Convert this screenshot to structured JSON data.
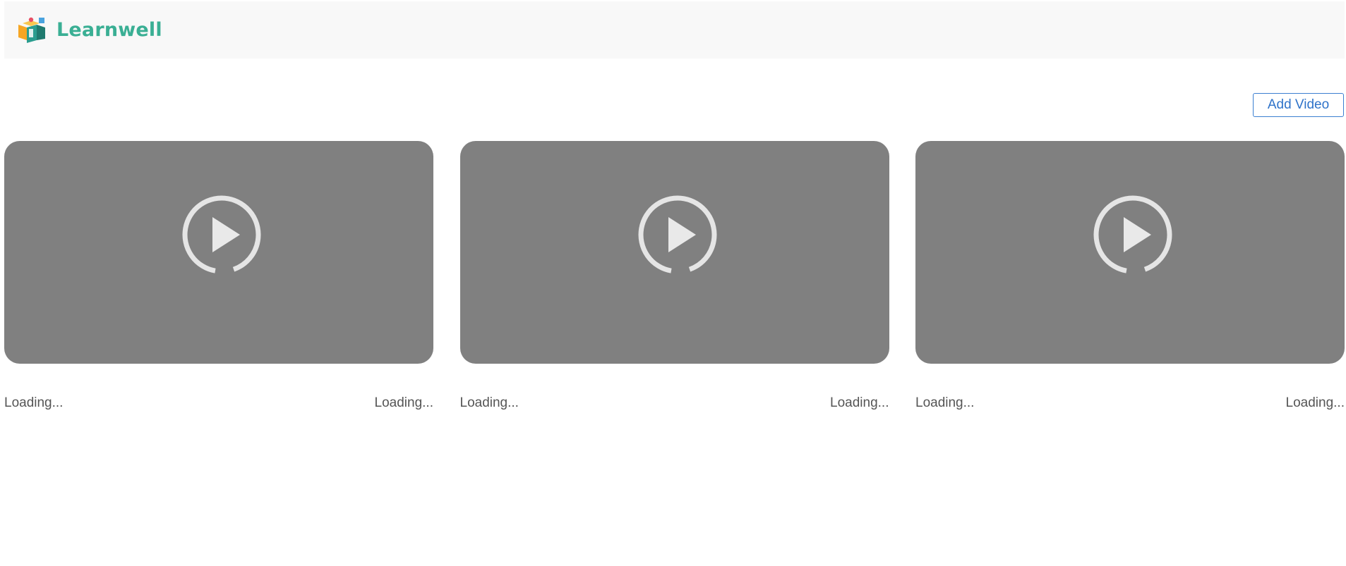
{
  "header": {
    "brand": "Learnwell",
    "logo_icon": "learnwell-logo-icon",
    "brand_color": "#3aaf94"
  },
  "toolbar": {
    "add_video_label": "Add Video"
  },
  "videos": [
    {
      "title": "Loading...",
      "meta": "Loading...",
      "icon": "play-circle-icon"
    },
    {
      "title": "Loading...",
      "meta": "Loading...",
      "icon": "play-circle-icon"
    },
    {
      "title": "Loading...",
      "meta": "Loading...",
      "icon": "play-circle-icon"
    }
  ],
  "colors": {
    "header_bg": "#f8f8f8",
    "thumbnail_bg": "#808080",
    "button_accent": "#3b7fd1",
    "text_muted": "#555555"
  }
}
